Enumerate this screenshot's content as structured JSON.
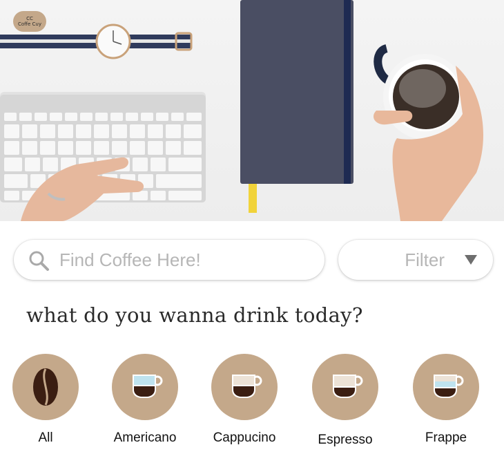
{
  "logo": {
    "line1": "CC",
    "line2": "Coffe Cuy"
  },
  "search": {
    "placeholder": "Find Coffee Here!",
    "value": ""
  },
  "filter": {
    "label": "Filter"
  },
  "heading": "what do you wanna drink today?",
  "categories": [
    {
      "label": "All",
      "icon": "coffee-bean-icon"
    },
    {
      "label": "Americano",
      "icon": "americano-cup-icon"
    },
    {
      "label": "Cappucino",
      "icon": "cappucino-cup-icon"
    },
    {
      "label": "Espresso",
      "icon": "espresso-cup-icon"
    },
    {
      "label": "Frappe",
      "icon": "frappe-cup-icon"
    }
  ],
  "colors": {
    "accent": "#c4a88a",
    "coffee_dark": "#3b1e12",
    "milk_light": "#ece2d6",
    "ice_blue": "#bfe3ef"
  }
}
